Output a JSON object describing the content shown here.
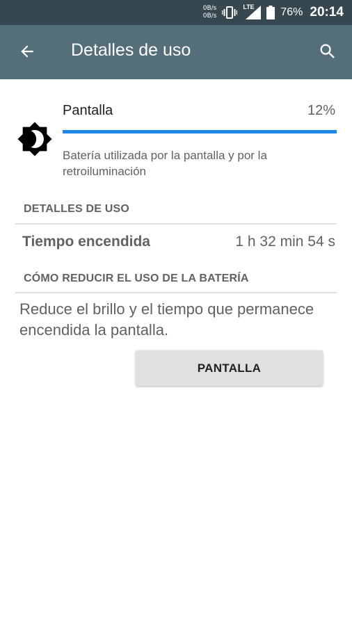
{
  "status_bar": {
    "net_up": "0B/s",
    "net_down": "0B/s",
    "vibrate_icon": "vibrate-icon",
    "network_type": "LTE",
    "signal_icon": "signal-icon",
    "battery_icon": "battery-icon",
    "battery_percent": "76%",
    "time": "20:14"
  },
  "app_bar": {
    "back_icon": "arrow-back-icon",
    "title": "Detalles de uso",
    "search_icon": "search-icon",
    "color": "#546E7A"
  },
  "usage": {
    "icon": "brightness-icon",
    "name": "Pantalla",
    "percent_label": "12%",
    "progress": 1.0,
    "description": "Batería utilizada por la pantalla y por la retroiluminación",
    "progress_color": "#1E88E5"
  },
  "details_section": {
    "header": "DETALLES DE USO",
    "rows": [
      {
        "label": "Tiempo encendida",
        "value": "1 h 32 min 54 s"
      }
    ]
  },
  "tips_section": {
    "header": "CÓMO REDUCIR EL USO DE LA BATERÍA",
    "tip": "Reduce el brillo y el tiempo que permanece encendida la pantalla.",
    "button_label": "PANTALLA"
  }
}
